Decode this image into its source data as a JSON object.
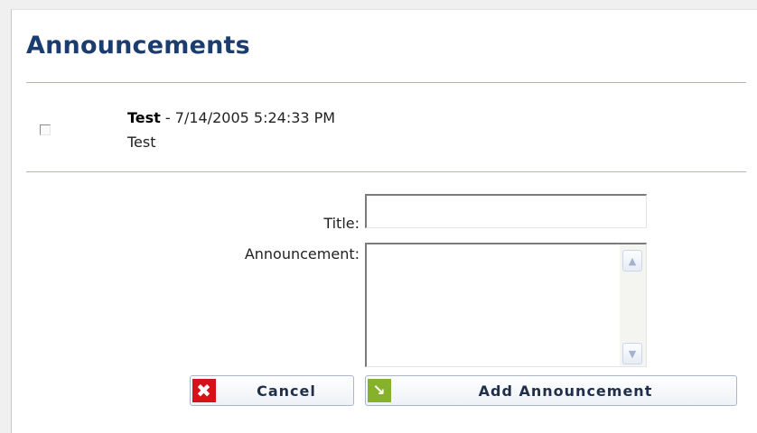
{
  "header": {
    "title": "Announcements"
  },
  "announcements": [
    {
      "title": "Test",
      "date": "- 7/14/2005 5:24:33 PM",
      "body": "Test"
    }
  ],
  "form": {
    "title_label": "Title:",
    "title_value": "",
    "announcement_label": "Announcement:",
    "announcement_value": ""
  },
  "buttons": {
    "cancel_label": "Cancel",
    "add_label": "Add Announcement"
  },
  "icons": {
    "cancel": "close-icon",
    "add": "arrow-down-right-icon",
    "scroll_up": "chevron-up-icon",
    "scroll_down": "chevron-down-icon"
  },
  "colors": {
    "title": "#1a3c6e",
    "cancel_icon_bg": "#d4121a",
    "add_icon_bg": "#86b22b"
  }
}
